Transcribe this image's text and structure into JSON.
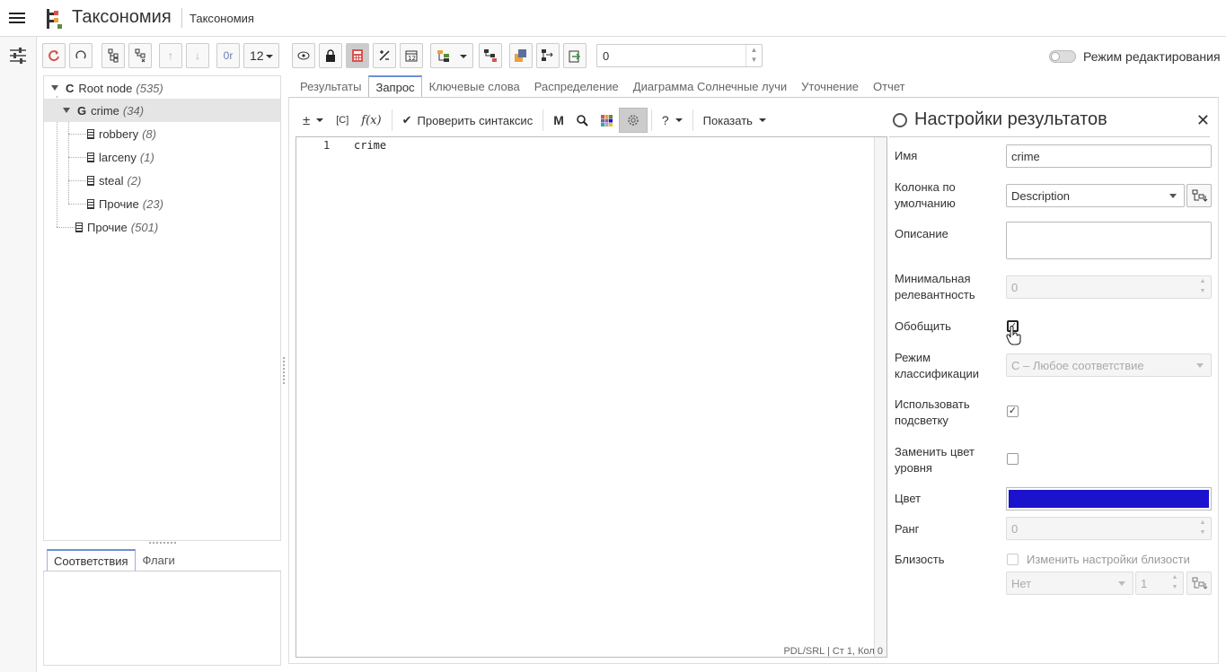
{
  "header": {
    "app_title": "Таксономия",
    "breadcrumb": "Таксономия"
  },
  "toolbar": {
    "font_size": "12",
    "or_label": "0r",
    "number_value": "0",
    "edit_mode_label": "Режим редактирования"
  },
  "tree": {
    "items": [
      {
        "letter": "C",
        "label": "Root node",
        "count": "(535)"
      },
      {
        "letter": "G",
        "label": "crime",
        "count": "(34)"
      },
      {
        "label": "robbery",
        "count": "(8)"
      },
      {
        "label": "larceny",
        "count": "(1)"
      },
      {
        "label": "steal",
        "count": "(2)"
      },
      {
        "label": "Прочие",
        "count": "(23)"
      },
      {
        "label": "Прочие",
        "count": "(501)"
      }
    ]
  },
  "bottom_tabs": [
    "Соответствия",
    "Флаги"
  ],
  "tabs": [
    "Результаты",
    "Запрос",
    "Ключевые слова",
    "Распределение",
    "Диаграмма Солнечные лучи",
    "Уточнение",
    "Отчет"
  ],
  "query_toolbar": {
    "plusminus": "±",
    "c_label": "[C]",
    "fx_label": "f(x)",
    "check_syntax": "Проверить синтаксис",
    "m_label": "M",
    "help_label": "?",
    "show_label": "Показать"
  },
  "editor": {
    "line_number": "1",
    "line_text": "crime",
    "status": "PDL/SRL | Ст 1, Кол 0"
  },
  "settings": {
    "title": "Настройки результатов",
    "name_label": "Имя",
    "name_value": "crime",
    "default_col_label": "Колонка по умолчанию",
    "default_col_value": "Description",
    "desc_label": "Описание",
    "minrel_label": "Минимальная релевантность",
    "minrel_value": "0",
    "generalize_label": "Обобщить",
    "classmode_label": "Режим классификации",
    "classmode_value": "С – Любое соответствие",
    "highlight_label": "Использовать подсветку",
    "replace_color_label": "Заменить цвет уровня",
    "color_label": "Цвет",
    "color_value": "#1a12cc",
    "rank_label": "Ранг",
    "rank_value": "0",
    "proximity_label": "Близость",
    "proximity_check_label": "Изменить настройки близости",
    "proximity_select": "Нет",
    "proximity_num": "1"
  }
}
